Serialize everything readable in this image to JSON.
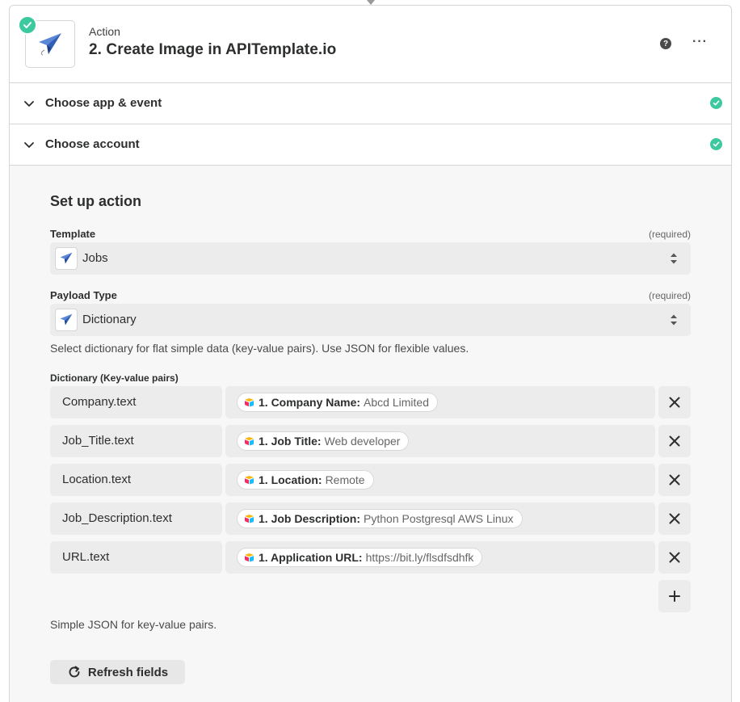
{
  "header": {
    "label": "Action",
    "title": "2. Create Image in APITemplate.io",
    "help": "?",
    "more": "···"
  },
  "sections": [
    {
      "label": "Choose app & event"
    },
    {
      "label": "Choose account"
    }
  ],
  "setup": {
    "title": "Set up action",
    "template": {
      "label": "Template",
      "required": "(required)",
      "value": "Jobs"
    },
    "payload_type": {
      "label": "Payload Type",
      "required": "(required)",
      "value": "Dictionary",
      "help": "Select dictionary for flat simple data (key-value pairs). Use JSON for flexible values."
    },
    "dictionary": {
      "label": "Dictionary (Key-value pairs)",
      "rows": [
        {
          "key": "Company.text",
          "pill_key": "1. Company Name:",
          "pill_value": "Abcd Limited"
        },
        {
          "key": "Job_Title.text",
          "pill_key": "1. Job Title:",
          "pill_value": "Web developer"
        },
        {
          "key": "Location.text",
          "pill_key": "1. Location:",
          "pill_value": "Remote"
        },
        {
          "key": "Job_Description.text",
          "pill_key": "1. Job Description:",
          "pill_value": "Python Postgresql AWS Linux"
        },
        {
          "key": "URL.text",
          "pill_key": "1. Application URL:",
          "pill_value": "https://bit.ly/flsdfsdhfk"
        }
      ],
      "help": "Simple JSON for key-value pairs."
    },
    "refresh_label": "Refresh fields"
  },
  "colors": {
    "success": "#3cc9a0",
    "field_bg": "#ececec",
    "panel_bg": "#f7f7f7"
  },
  "icons": {
    "app": "paper-plane-icon",
    "success": "check-icon",
    "source": "airtable-icon"
  }
}
